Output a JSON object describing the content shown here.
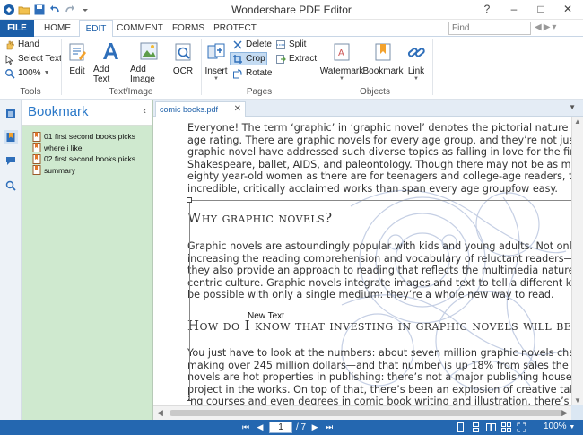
{
  "window": {
    "title": "Wondershare PDF Editor",
    "controls": {
      "help": "?",
      "minimize": "–",
      "restore": "□",
      "close": "✕"
    }
  },
  "tabs": {
    "file": "FILE",
    "home": "HOME",
    "edit": "EDIT",
    "comment": "COMMENT",
    "forms": "FORMS",
    "protect": "PROTECT"
  },
  "search": {
    "placeholder": "Find"
  },
  "ribbon": {
    "tools": {
      "label": "Tools",
      "hand": "Hand",
      "select_text": "Select Text",
      "zoom": "100%"
    },
    "text_image": {
      "label": "Text/Image",
      "edit": "Edit",
      "add_text": "Add Text",
      "add_image": "Add Image",
      "ocr": "OCR"
    },
    "pages": {
      "label": "Pages",
      "insert": "Insert",
      "delete": "Delete",
      "crop": "Crop",
      "rotate": "Rotate",
      "split": "Split",
      "extract": "Extract"
    },
    "objects": {
      "label": "Objects",
      "watermark": "Watermark",
      "bookmark": "Bookmark",
      "link": "Link"
    }
  },
  "bookmark_panel": {
    "title": "Bookmark",
    "items": [
      {
        "label": "01 first second books picks"
      },
      {
        "label": "where i like"
      },
      {
        "label": "02 first second books picks"
      },
      {
        "label": "summary"
      }
    ]
  },
  "document": {
    "tab": "comic books.pdf",
    "paragraph1": [
      "Everyone!  The term ‘graphic’ in ‘graphic novel’ denotes the pictorial nature of the m",
      "age rating.  There are graphic novels for every age group, and they’re not just ab",
      "graphic novel have addressed such diverse topics as falling in love for the first tim",
      "Shakespeare, ballet, AIDS, and paleontology.  Though there may not be as many",
      "eighty year-old women as there are for teenagers and college-age readers, the med",
      "incredible, critically acclaimed works than span every age groupfow easy."
    ],
    "heading1": "Why graphic novels?",
    "paragraph2": [
      "Graphic novels are astoundingly popular with kids and young adults.  Not only",
      "increasing the reading comprehension and vocabulary of reluctant readers—and e",
      "they also provide an approach to reading that reflects the multimedia nature of to",
      "centric culture.  Graphic novels integrate images and text to tell a different kind o",
      "be possible with only a single medium: they’re a whole new way to read."
    ],
    "new_text_label": "New Text",
    "heading2": "How do I know that investing in graphic novels will be worth it?",
    "paragraph3": [
      "You just have to look at the numbers: about seven million graphic novels change",
      "making over 245 million dollars—and that number is up 18% from sales the year",
      "novels are hot properties in publishing: there’s not a major publishing house witho",
      "project in the works.  On top of that, there’s been an explosion of creative talent.  W",
      "ing courses and even degrees in comic book writing and illustration, there’s a larg"
    ]
  },
  "status": {
    "current_page": "1",
    "total_pages": "/ 7",
    "zoom": "100%"
  },
  "colors": {
    "accent": "#1b5ea8",
    "statusbar": "#2467b0",
    "bookmark_panel_bg": "#cfe9cf",
    "bookmark_title": "#2a78c8"
  }
}
